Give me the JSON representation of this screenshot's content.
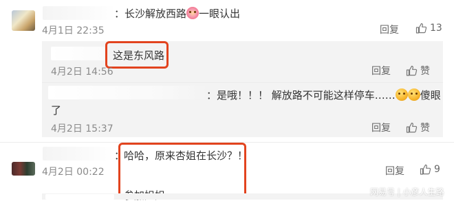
{
  "comments": [
    {
      "text_prefix": "：长沙解放西路",
      "text_suffix": "一眼认出",
      "emoji": "flower-face-emoji",
      "date": "4月1日 22:35",
      "reply_label": "回复",
      "like_count": "13",
      "replies": [
        {
          "text": "这是东风路",
          "date": "4月2日 14:56",
          "reply_label": "回复",
          "like_label": "赞"
        },
        {
          "text_line1": "：是哦！！！ 解放路不可能这样停车……",
          "text_after_emoji": "傻眼",
          "text_line2": "了",
          "date": "4月2日 15:37",
          "reply_label": "回复",
          "like_label": "赞"
        }
      ]
    },
    {
      "text_prefix": "：",
      "text_line1": "哈哈，原来杏姐在长沙？！",
      "text_line2": "参加姐姐",
      "date": "4月2日 00:22",
      "reply_label": "回复",
      "like_count": "9"
    }
  ],
  "watermark": "网易号 | 小彦人生路",
  "colors": {
    "highlight": "#e2431e",
    "reply_bg": "#f3f3f3",
    "meta": "#8a8a8a"
  }
}
